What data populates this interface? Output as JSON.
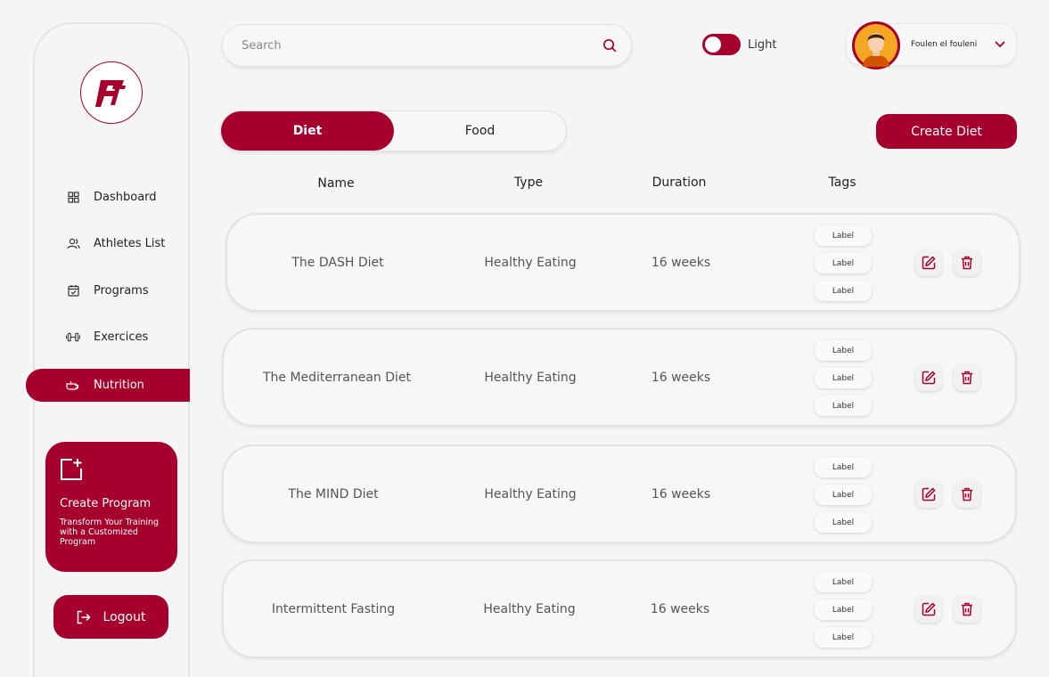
{
  "colors": {
    "accent": "#a6002d",
    "background": "#f5f5f5"
  },
  "sidebar": {
    "logo_icon": "ft-logo-icon",
    "items": [
      {
        "label": "Dashboard",
        "icon": "grid-icon"
      },
      {
        "label": "Athletes List",
        "icon": "users-icon"
      },
      {
        "label": "Programs",
        "icon": "calendar-check-icon"
      },
      {
        "label": "Exercices",
        "icon": "dumbbell-icon"
      },
      {
        "label": "Nutrition",
        "icon": "nutrition-icon",
        "active": true
      }
    ],
    "create_card": {
      "title": "Create  Program",
      "subtitle": "Transform Your Training with a Customized Program",
      "icon": "add-square-icon"
    },
    "logout_label": "Logout"
  },
  "header": {
    "search_placeholder": "Search",
    "search_value": "",
    "theme_label": "Light",
    "user_name": "Foulen el fouleni"
  },
  "tabs": [
    {
      "label": "Diet",
      "active": true
    },
    {
      "label": "Food",
      "active": false
    }
  ],
  "create_diet_label": "Create Diet",
  "table": {
    "columns": [
      "Name",
      "Type",
      "Duration",
      "Tags"
    ],
    "rows": [
      {
        "name": "The DASH Diet",
        "type": "Healthy Eating",
        "duration": "16 weeks",
        "tags": [
          "Label",
          "Label",
          "Label"
        ]
      },
      {
        "name": "The Mediterranean Diet",
        "type": "Healthy Eating",
        "duration": "16 weeks",
        "tags": [
          "Label",
          "Label",
          "Label"
        ]
      },
      {
        "name": "The MIND Diet",
        "type": "Healthy Eating",
        "duration": "16 weeks",
        "tags": [
          "Label",
          "Label",
          "Label"
        ]
      },
      {
        "name": "Intermittent Fasting",
        "type": "Healthy Eating",
        "duration": "16 weeks",
        "tags": [
          "Label",
          "Label",
          "Label"
        ]
      }
    ]
  }
}
